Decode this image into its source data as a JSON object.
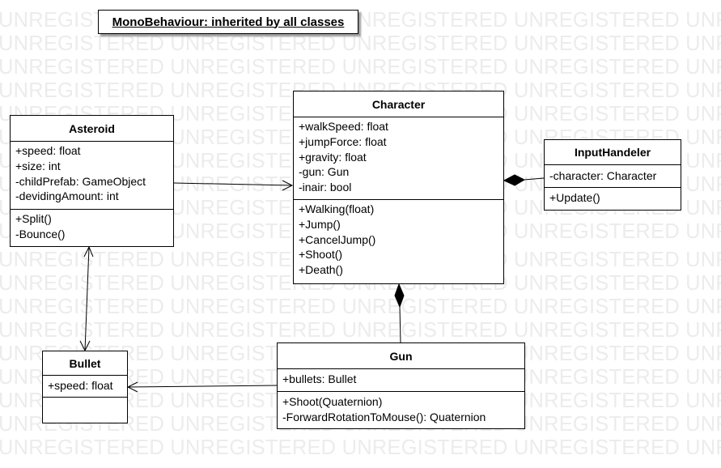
{
  "watermark": "UNREGISTERED UNREGISTERED UNREGISTERED UNREGISTERED UNREGISTERED",
  "note": "MonoBehaviour: inherited by all classes",
  "classes": {
    "asteroid": {
      "name": "Asteroid",
      "attributes": [
        "+speed: float",
        "+size: int",
        "-childPrefab: GameObject",
        "-devidingAmount: int"
      ],
      "methods": [
        "+Split()",
        "-Bounce()"
      ]
    },
    "character": {
      "name": "Character",
      "attributes": [
        "+walkSpeed: float",
        "+jumpForce: float",
        "+gravity: float",
        "-gun: Gun",
        "-inair: bool"
      ],
      "methods": [
        "+Walking(float)",
        "+Jump()",
        "+CancelJump()",
        "+Shoot()",
        "+Death()"
      ]
    },
    "inputhandeler": {
      "name": "InputHandeler",
      "attributes": [
        "-character: Character"
      ],
      "methods": [
        "+Update()"
      ]
    },
    "bullet": {
      "name": "Bullet",
      "attributes": [
        "+speed: float"
      ],
      "methods": []
    },
    "gun": {
      "name": "Gun",
      "attributes": [
        "+bullets: Bullet"
      ],
      "methods": [
        "+Shoot(Quaternion)",
        "-ForwardRotationToMouse(): Quaternion"
      ]
    }
  }
}
